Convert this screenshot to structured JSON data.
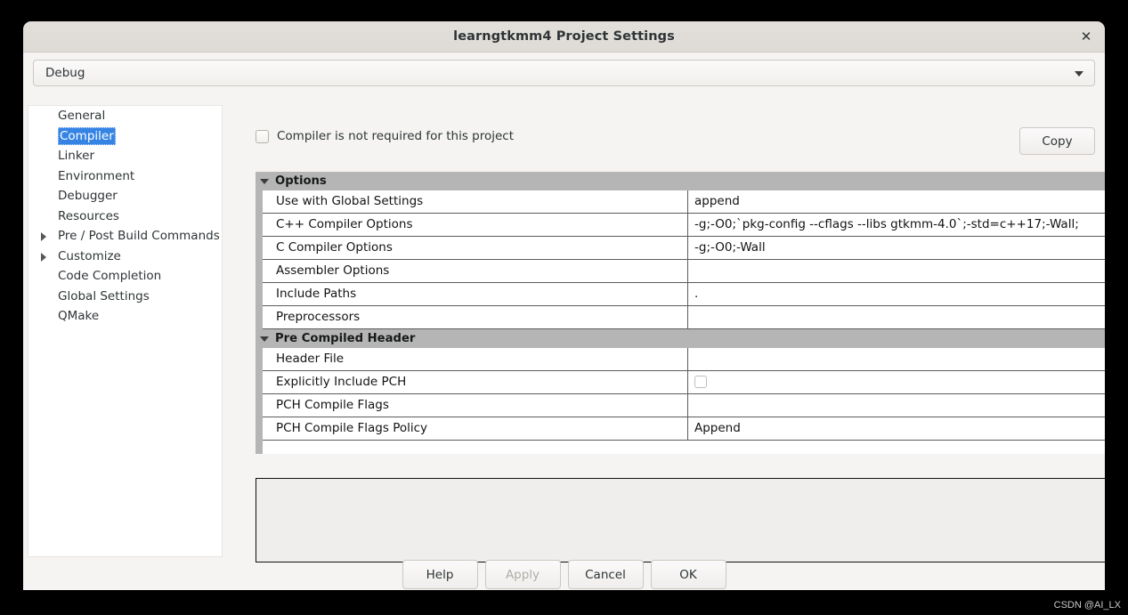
{
  "window": {
    "title": "learngtkmm4 Project Settings",
    "close_icon": "close-icon"
  },
  "config_selector": {
    "selected": "Debug",
    "arrow_icon": "chevron-down-icon"
  },
  "sidebar": {
    "items": [
      {
        "label": "General",
        "expandable": false,
        "selected": false
      },
      {
        "label": "Compiler",
        "expandable": false,
        "selected": true
      },
      {
        "label": "Linker",
        "expandable": false,
        "selected": false
      },
      {
        "label": "Environment",
        "expandable": false,
        "selected": false
      },
      {
        "label": "Debugger",
        "expandable": false,
        "selected": false
      },
      {
        "label": "Resources",
        "expandable": false,
        "selected": false
      },
      {
        "label": "Pre / Post Build Commands",
        "expandable": true,
        "selected": false
      },
      {
        "label": "Customize",
        "expandable": true,
        "selected": false
      },
      {
        "label": "Code Completion",
        "expandable": false,
        "selected": false
      },
      {
        "label": "Global Settings",
        "expandable": false,
        "selected": false
      },
      {
        "label": "QMake",
        "expandable": false,
        "selected": false
      }
    ]
  },
  "toolbar": {
    "not_required_checkbox_label": "Compiler is not required for this project",
    "not_required_checked": false,
    "copy_label": "Copy"
  },
  "settings_table": {
    "groups": [
      {
        "title": "Options",
        "expanded": true,
        "rows": [
          {
            "name": "Use with Global Settings",
            "value": "append",
            "type": "text"
          },
          {
            "name": "C++ Compiler Options",
            "value": "-g;-O0;`pkg-config --cflags --libs gtkmm-4.0`;-std=c++17;-Wall;",
            "type": "text"
          },
          {
            "name": "C Compiler Options",
            "value": "-g;-O0;-Wall",
            "type": "text"
          },
          {
            "name": "Assembler Options",
            "value": "",
            "type": "text"
          },
          {
            "name": "Include Paths",
            "value": ".",
            "type": "text"
          },
          {
            "name": "Preprocessors",
            "value": "",
            "type": "text"
          }
        ]
      },
      {
        "title": "Pre Compiled Header",
        "expanded": true,
        "rows": [
          {
            "name": "Header File",
            "value": "",
            "type": "text"
          },
          {
            "name": "Explicitly Include PCH",
            "value": "",
            "type": "checkbox",
            "checked": false
          },
          {
            "name": "PCH Compile Flags",
            "value": "",
            "type": "text"
          },
          {
            "name": "PCH Compile Flags Policy",
            "value": "Append",
            "type": "text"
          }
        ]
      }
    ]
  },
  "description_panel": {
    "text": ""
  },
  "actions": [
    {
      "label": "Help",
      "disabled": false
    },
    {
      "label": "Apply",
      "disabled": true
    },
    {
      "label": "Cancel",
      "disabled": false
    },
    {
      "label": "OK",
      "disabled": false
    }
  ],
  "watermark": "CSDN @AI_LX",
  "colors": {
    "selection": "#3584e4",
    "group_header_bg": "#b5b5b5",
    "window_bg": "#f5f4f2",
    "titlebar_bg": "#dedbd6"
  }
}
